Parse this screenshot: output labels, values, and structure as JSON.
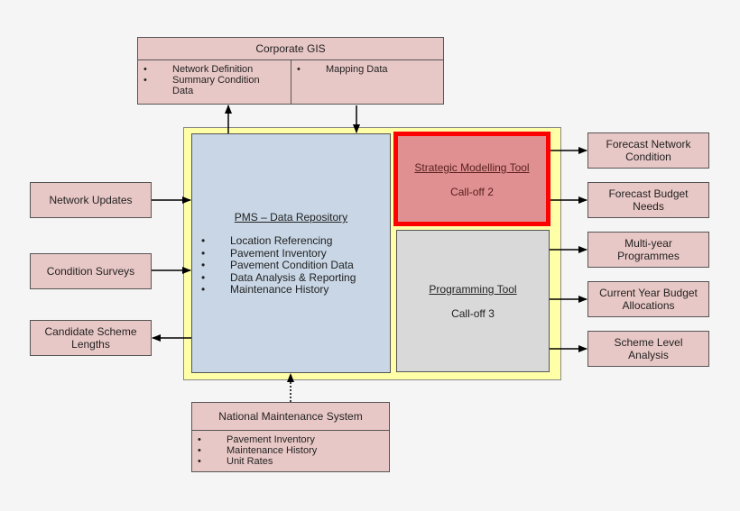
{
  "corporate_gis": {
    "title": "Corporate GIS",
    "left_items": [
      "Network Definition",
      "Summary Condition Data"
    ],
    "right_items": [
      "Mapping Data"
    ]
  },
  "pms": {
    "title": "PMS – Data Repository",
    "items": [
      "Location Referencing",
      "Pavement Inventory",
      "Pavement Condition Data",
      "Data Analysis & Reporting",
      "Maintenance History"
    ]
  },
  "strategic_tool": {
    "title": "Strategic Modelling Tool",
    "subtitle": "Call-off 2",
    "highlight_color": "#ff0000"
  },
  "programming_tool": {
    "title": "Programming Tool",
    "subtitle": "Call-off 3"
  },
  "inputs": {
    "network_updates": "Network Updates",
    "condition_surveys": "Condition Surveys",
    "candidate_scheme_lengths": "Candidate Scheme Lengths"
  },
  "outputs": [
    "Forecast Network Condition",
    "Forecast Budget Needs",
    "Multi-year Programmes",
    "Current Year Budget Allocations",
    "Scheme Level Analysis"
  ],
  "nms": {
    "title": "National Maintenance System",
    "items": [
      "Pavement Inventory",
      "Maintenance History",
      "Unit Rates"
    ]
  },
  "colors": {
    "pink": "#e8c8c6",
    "yellow": "#ffffa8",
    "blue": "#c8d6e5",
    "grey": "#d9d9d9",
    "strategic_fill": "#e09090"
  }
}
